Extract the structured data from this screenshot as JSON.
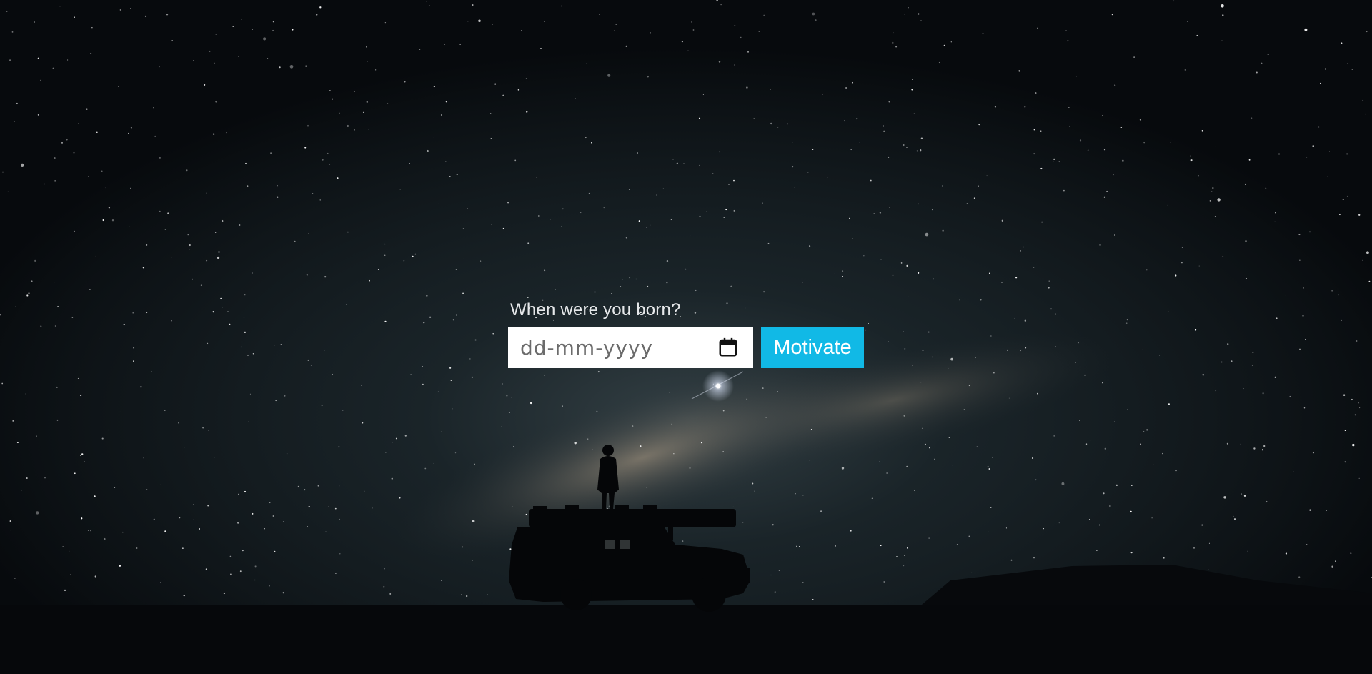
{
  "form": {
    "prompt": "When were you born?",
    "date_placeholder": "dd-mm-yyyy",
    "submit_label": "Motivate",
    "calendar_icon": "calendar-icon"
  },
  "colors": {
    "button": "#11b9e6",
    "field_bg": "#ffffff",
    "label_text": "#e6e8ea",
    "sky_dark": "#05070a"
  },
  "background": {
    "scene": "night sky with milky way, silhouette of person standing on top of an off-road vehicle"
  }
}
